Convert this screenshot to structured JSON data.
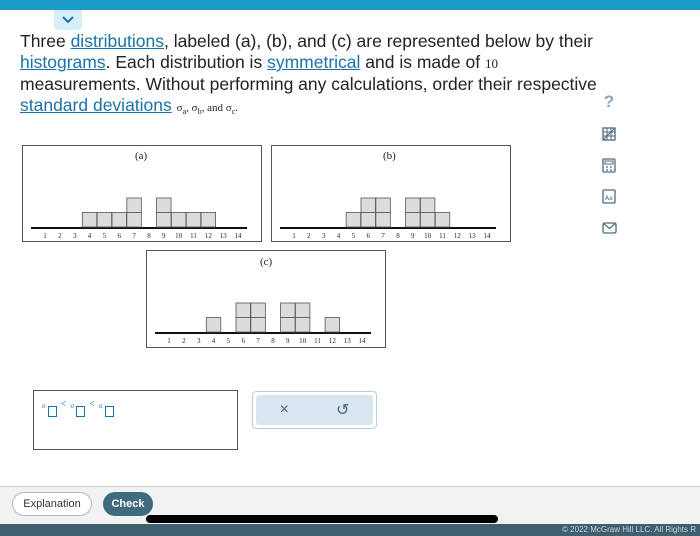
{
  "question": {
    "t1": "Three ",
    "link_distributions": "distributions",
    "t2": ", labeled (a), (b), and (c) are represented below by their ",
    "link_histograms": "histograms",
    "t3": ". Each distribution is ",
    "link_symmetrical": "symmetrical",
    "t4": " and is made of ",
    "count": "10",
    "t5": " measurements. Without performing any calculations, order their respective ",
    "link_std": "standard deviations",
    "sigma": "σ",
    "sub_a": "a",
    "sub_b": "b",
    "sub_c": "c",
    "sep1": ", ",
    "sep2": ", and ",
    "end": "."
  },
  "histograms": {
    "axis_ticks": [
      "1",
      "2",
      "3",
      "4",
      "5",
      "6",
      "7",
      "8",
      "9",
      "10",
      "11",
      "12",
      "13",
      "14"
    ],
    "a": {
      "label": "(a)",
      "heights": [
        0,
        0,
        0,
        1,
        1,
        1,
        2,
        0,
        2,
        1,
        1,
        1,
        0,
        0
      ]
    },
    "b": {
      "label": "(b)",
      "heights": [
        0,
        0,
        0,
        0,
        1,
        2,
        2,
        0,
        2,
        2,
        1,
        0,
        0,
        0
      ]
    },
    "c": {
      "label": "(c)",
      "heights": [
        0,
        0,
        0,
        1,
        0,
        2,
        2,
        0,
        2,
        2,
        0,
        1,
        0,
        0
      ]
    }
  },
  "answer": {
    "less_than": "<"
  },
  "actions": {
    "clear": "×",
    "undo": "↺"
  },
  "tools": [
    "help-icon",
    "data-table-icon",
    "calculator-icon",
    "glossary-icon",
    "message-icon"
  ],
  "tools_help_glyph": "?",
  "footer": {
    "explanation_label": "Explanation",
    "check_label": "Check",
    "copyright": "© 2022 McGraw Hill LLC. All Rights R"
  },
  "colors": {
    "accent": "#1b9bc8",
    "link": "#1a73a8",
    "check_button": "#3e6b80"
  }
}
